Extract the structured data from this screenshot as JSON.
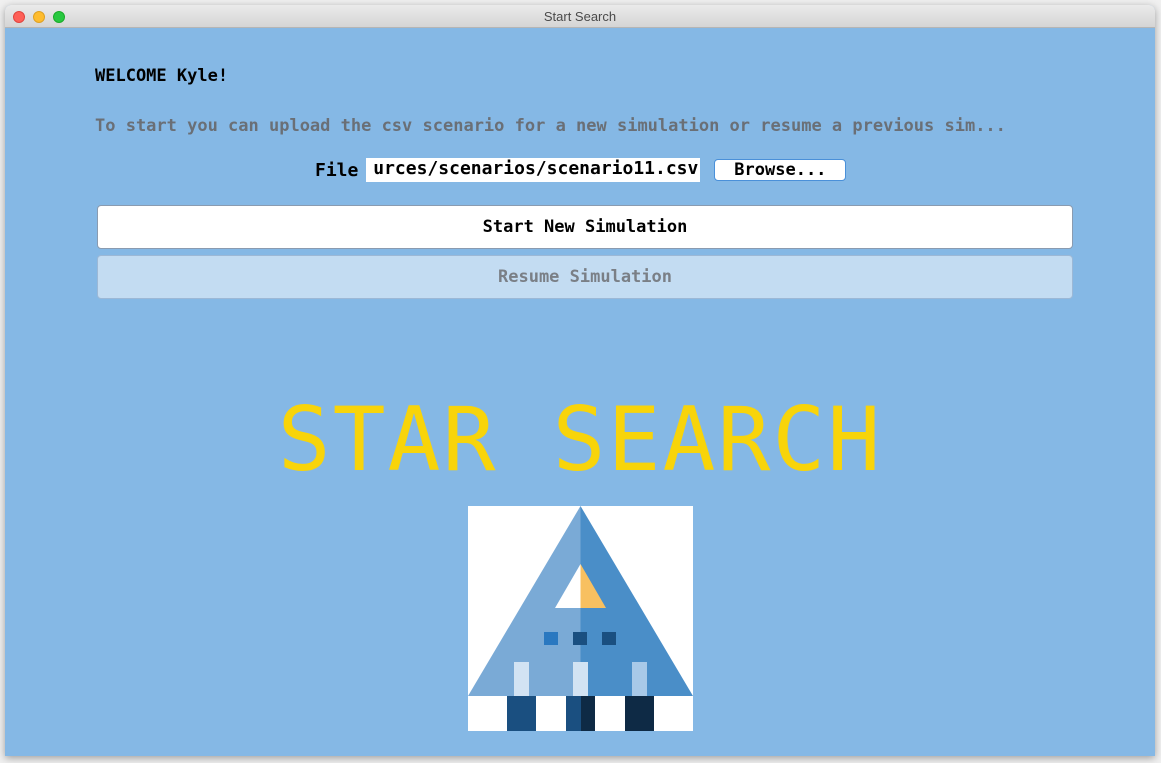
{
  "window": {
    "title": "Start Search"
  },
  "welcome_text": "WELCOME Kyle!",
  "instructions_text": "To start you can upload the csv scenario for a new simulation or resume a previous sim...",
  "file": {
    "label": "File",
    "value": "urces/scenarios/scenario11.csv",
    "browse_label": "Browse..."
  },
  "buttons": {
    "start_label": "Start New Simulation",
    "resume_label": "Resume Simulation",
    "resume_enabled": false
  },
  "hero_title": "STAR SEARCH",
  "colors": {
    "background": "#85b8e5",
    "hero_text": "#f8d40a",
    "logo_light_blue": "#7aaad6",
    "logo_mid_blue": "#4a8ec8",
    "logo_dark_blue": "#1a4f80",
    "logo_navy": "#0e2a45",
    "logo_orange": "#f8c060"
  },
  "logo": {
    "icon": "triangle-robot-logo"
  }
}
